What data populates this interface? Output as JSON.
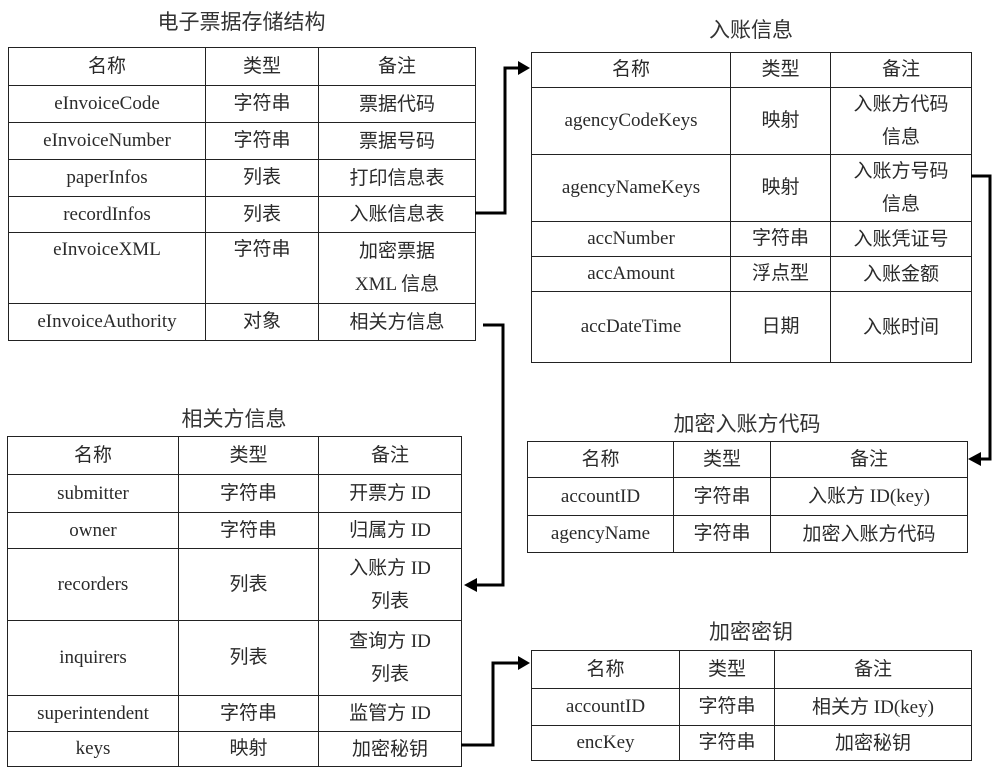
{
  "header": [
    "名称",
    "类型",
    "备注"
  ],
  "tables": {
    "invoice_storage": {
      "title": "电子票据存储结构",
      "rows": [
        {
          "name": "eInvoiceCode",
          "type": "字符串",
          "note": [
            "票据代码"
          ]
        },
        {
          "name": "eInvoiceNumber",
          "type": "字符串",
          "note": [
            "票据号码"
          ]
        },
        {
          "name": "paperInfos",
          "type": "列表",
          "note": [
            "打印信息表"
          ]
        },
        {
          "name": "recordInfos",
          "type": "列表",
          "note": [
            "入账信息表"
          ]
        },
        {
          "name": "eInvoiceXML",
          "type": "字符串",
          "note": [
            "加密票据",
            "XML 信息"
          ]
        },
        {
          "name": "eInvoiceAuthority",
          "type": "对象",
          "note": [
            "相关方信息"
          ]
        }
      ]
    },
    "record_info": {
      "title": "入账信息",
      "rows": [
        {
          "name": "agencyCodeKeys",
          "type": "映射",
          "note": [
            "入账方代码",
            "信息"
          ]
        },
        {
          "name": "agencyNameKeys",
          "type": "映射",
          "note": [
            "入账方号码",
            "信息"
          ]
        },
        {
          "name": "accNumber",
          "type": "字符串",
          "note": [
            "入账凭证号"
          ]
        },
        {
          "name": "accAmount",
          "type": "浮点型",
          "note": [
            "入账金额"
          ]
        },
        {
          "name": "accDateTime",
          "type": "日期",
          "note": [
            "入账时间"
          ]
        }
      ]
    },
    "encrypted_agency_code": {
      "title": "加密入账方代码",
      "rows": [
        {
          "name": "accountID",
          "type": "字符串",
          "note": [
            "入账方 ID(key)"
          ]
        },
        {
          "name": "agencyName",
          "type": "字符串",
          "note": [
            "加密入账方代码"
          ]
        }
      ]
    },
    "related_party": {
      "title": "相关方信息",
      "rows": [
        {
          "name": "submitter",
          "type": "字符串",
          "note": [
            "开票方 ID"
          ]
        },
        {
          "name": "owner",
          "type": "字符串",
          "note": [
            "归属方 ID"
          ]
        },
        {
          "name": "recorders",
          "type": "列表",
          "note": [
            "入账方 ID",
            "列表"
          ]
        },
        {
          "name": "inquirers",
          "type": "列表",
          "note": [
            "查询方 ID",
            "列表"
          ]
        },
        {
          "name": "superintendent",
          "type": "字符串",
          "note": [
            "监管方 ID"
          ]
        },
        {
          "name": "keys",
          "type": "映射",
          "note": [
            "加密秘钥"
          ]
        }
      ]
    },
    "encryption_key": {
      "title": "加密密钥",
      "rows": [
        {
          "name": "accountID",
          "type": "字符串",
          "note": [
            "相关方 ID(key)"
          ]
        },
        {
          "name": "encKey",
          "type": "字符串",
          "note": [
            "加密秘钥"
          ]
        }
      ]
    }
  },
  "connectors": [
    {
      "from": "invoice_storage.recordInfos",
      "to": "record_info",
      "icon": "arrow-right-icon"
    },
    {
      "from": "invoice_storage.eInvoiceAuthority",
      "to": "related_party.recorders",
      "icon": "arrow-left-icon"
    },
    {
      "from": "record_info.agencyNameKeys",
      "to": "encrypted_agency_code",
      "icon": "arrow-left-icon"
    },
    {
      "from": "related_party.keys",
      "to": "encryption_key",
      "icon": "arrow-right-icon"
    }
  ]
}
